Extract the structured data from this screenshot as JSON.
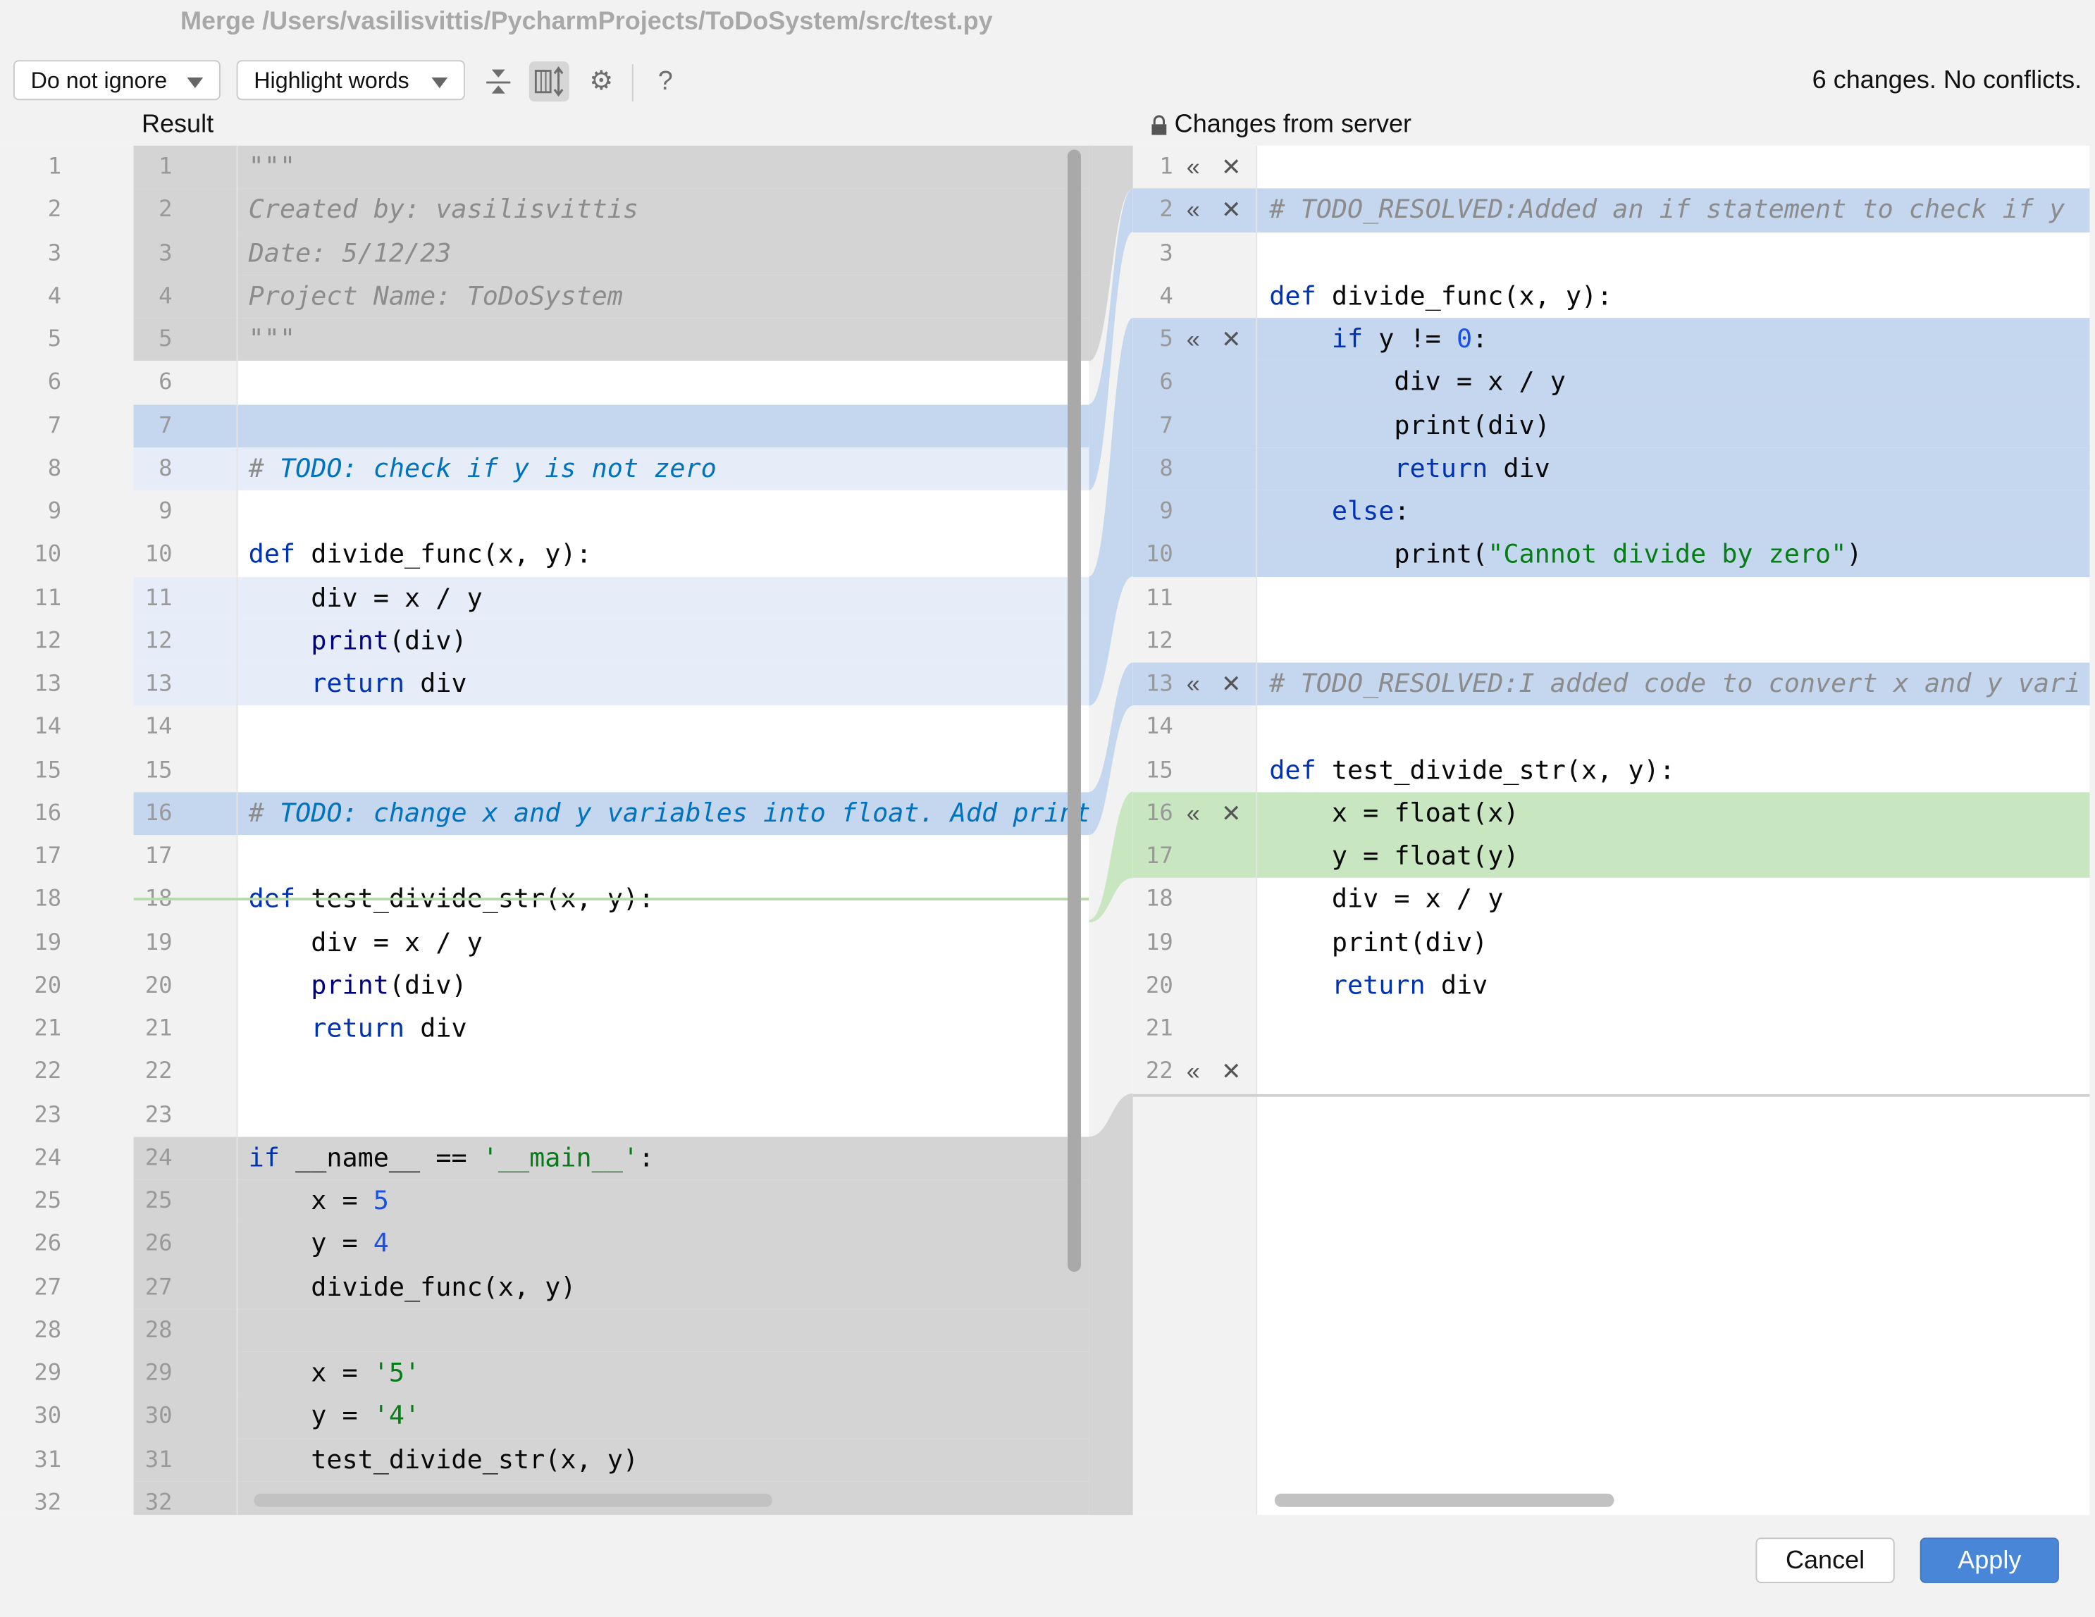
{
  "window": {
    "title": "Merge /Users/vasilisvittis/PycharmProjects/ToDoSystem/src/test.py"
  },
  "toolbar": {
    "ignore_select": "Do not ignore",
    "highlight_select": "Highlight words",
    "icons": [
      "collapse-unchanged-icon",
      "sync-scroll-icon",
      "gear-icon",
      "help-icon"
    ],
    "help_label": "?",
    "status": "6 changes. No conflicts."
  },
  "left": {
    "title": "Result",
    "lines": [
      [
        [
          "cm",
          "\"\"\""
        ]
      ],
      [
        [
          "cm",
          "Created by: vasilisvittis"
        ]
      ],
      [
        [
          "cm",
          "Date: 5/12/23"
        ]
      ],
      [
        [
          "cm",
          "Project Name: ToDoSystem"
        ]
      ],
      [
        [
          "cm",
          "\"\"\""
        ]
      ],
      [],
      [],
      [
        [
          "cm",
          "# "
        ],
        [
          "todo",
          "TODO: check if y is not zero"
        ]
      ],
      [],
      [
        [
          "kw",
          "def "
        ],
        [
          "tx",
          "divide_func(x, y):"
        ]
      ],
      [
        [
          "tx",
          "    div = x / y"
        ]
      ],
      [
        [
          "tx",
          "    "
        ],
        [
          "bi",
          "print"
        ],
        [
          "tx",
          "(div)"
        ]
      ],
      [
        [
          "tx",
          "    "
        ],
        [
          "kw",
          "return "
        ],
        [
          "tx",
          "div"
        ]
      ],
      [],
      [],
      [
        [
          "cm",
          "# "
        ],
        [
          "todo",
          "TODO: change x and y variables into float. Add print"
        ]
      ],
      [],
      [
        [
          "kw",
          "def "
        ],
        [
          "tx",
          "test_divide_str(x, y):"
        ]
      ],
      [
        [
          "tx",
          "    div = x / y"
        ]
      ],
      [
        [
          "tx",
          "    "
        ],
        [
          "bi",
          "print"
        ],
        [
          "tx",
          "(div)"
        ]
      ],
      [
        [
          "tx",
          "    "
        ],
        [
          "kw",
          "return "
        ],
        [
          "tx",
          "div"
        ]
      ],
      [],
      [],
      [
        [
          "kw",
          "if "
        ],
        [
          "tx",
          "__name__ == "
        ],
        [
          "str",
          "'__main__'"
        ],
        [
          "tx",
          ":"
        ]
      ],
      [
        [
          "tx",
          "    x = "
        ],
        [
          "num",
          "5"
        ]
      ],
      [
        [
          "tx",
          "    y = "
        ],
        [
          "num",
          "4"
        ]
      ],
      [
        [
          "tx",
          "    divide_func(x, y)"
        ]
      ],
      [],
      [
        [
          "tx",
          "    x = "
        ],
        [
          "str",
          "'5'"
        ]
      ],
      [
        [
          "tx",
          "    y = "
        ],
        [
          "str",
          "'4'"
        ]
      ],
      [
        [
          "tx",
          "    test_divide_str(x, y)"
        ]
      ],
      []
    ]
  },
  "right": {
    "title": "Changes from server",
    "lines": [
      [],
      [
        [
          "cm",
          "# TODO_RESOLVED:Added an if statement to check if y"
        ]
      ],
      [],
      [
        [
          "kw",
          "def "
        ],
        [
          "tx",
          "divide_func(x, y):"
        ]
      ],
      [
        [
          "tx",
          "    "
        ],
        [
          "kw",
          "if "
        ],
        [
          "tx",
          "y != "
        ],
        [
          "num",
          "0"
        ],
        [
          "tx",
          ":"
        ]
      ],
      [
        [
          "tx",
          "        div = x / y"
        ]
      ],
      [
        [
          "tx",
          "        print(div)"
        ]
      ],
      [
        [
          "tx",
          "        "
        ],
        [
          "kw",
          "return "
        ],
        [
          "tx",
          "div"
        ]
      ],
      [
        [
          "tx",
          "    "
        ],
        [
          "kw",
          "else"
        ],
        [
          "tx",
          ":"
        ]
      ],
      [
        [
          "tx",
          "        print("
        ],
        [
          "str",
          "\"Cannot divide by zero\""
        ],
        [
          "tx",
          ")"
        ]
      ],
      [],
      [],
      [
        [
          "cm",
          "# TODO_RESOLVED:I added code to convert x and y vari"
        ]
      ],
      [],
      [
        [
          "kw",
          "def "
        ],
        [
          "tx",
          "test_divide_str(x, y):"
        ]
      ],
      [
        [
          "tx",
          "    x = float(x)"
        ]
      ],
      [
        [
          "tx",
          "    y = float(y)"
        ]
      ],
      [
        [
          "tx",
          "    div = x / y"
        ]
      ],
      [
        [
          "tx",
          "    print(div)"
        ]
      ],
      [
        [
          "tx",
          "    "
        ],
        [
          "kw",
          "return "
        ],
        [
          "tx",
          "div"
        ]
      ],
      [],
      []
    ],
    "action_lines": [
      1,
      2,
      5,
      13,
      16,
      22
    ]
  },
  "footer": {
    "cancel": "Cancel",
    "apply": "Apply"
  },
  "colors": {
    "changed": "#c5d6ef",
    "changed_light": "#e6edf8",
    "unchanged_gray": "#d4d4d4",
    "inserted": "#c8e6c0",
    "apply_button": "#4a86d8"
  }
}
